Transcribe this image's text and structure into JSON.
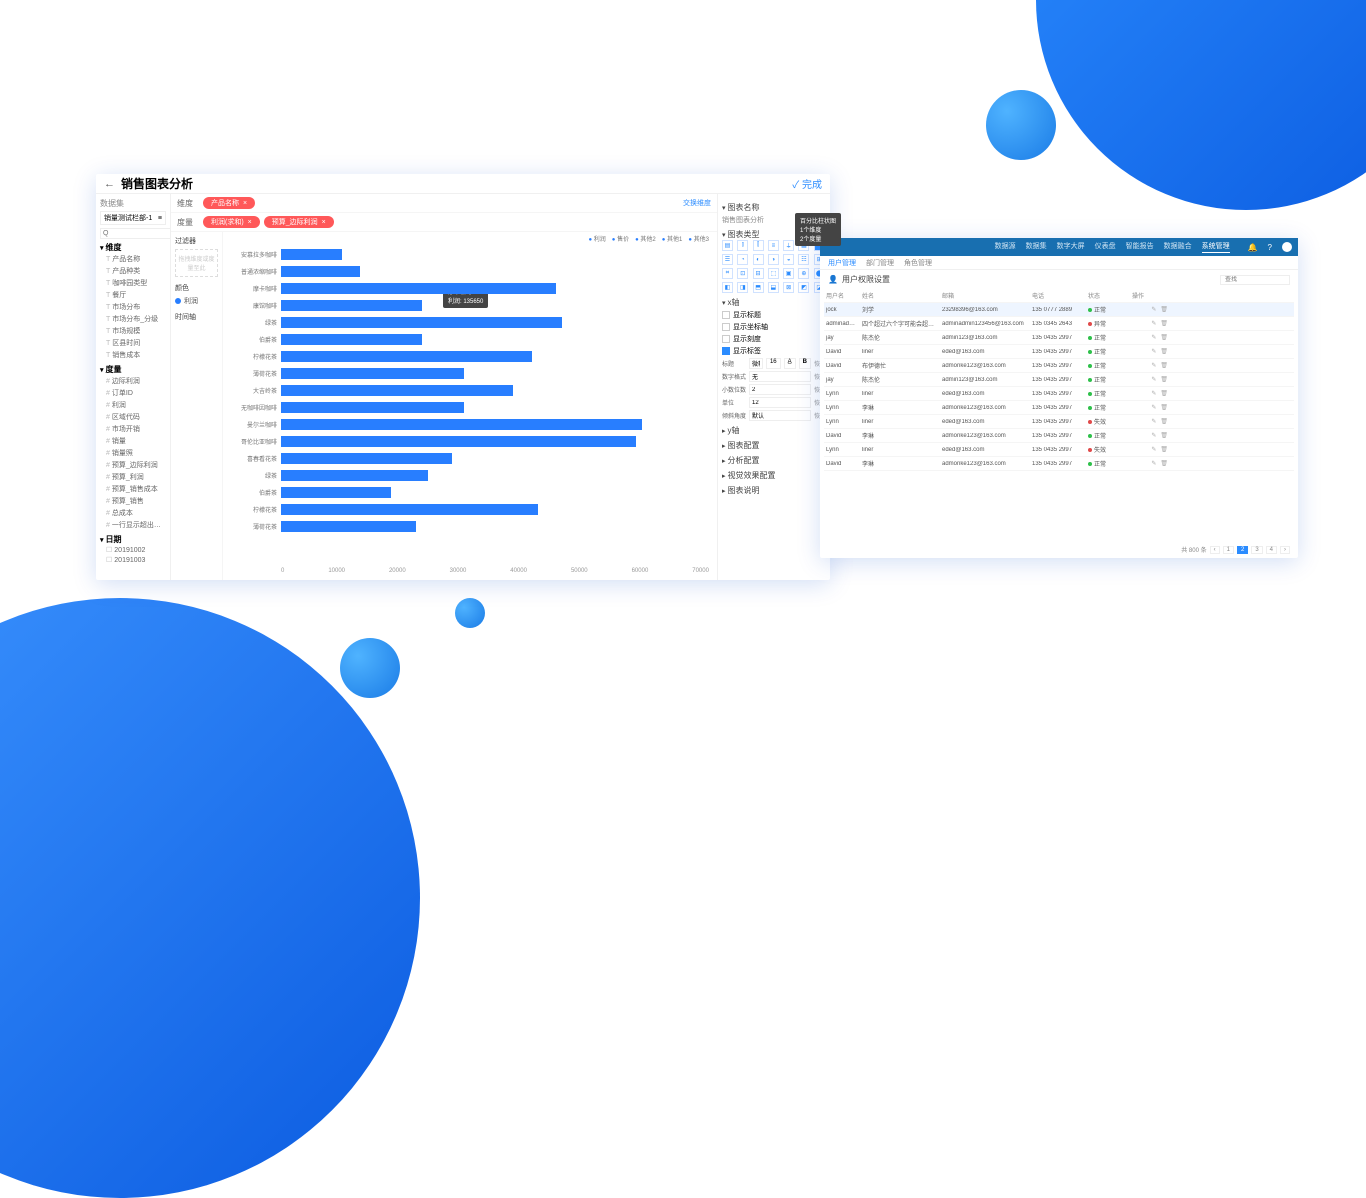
{
  "app1": {
    "title": "销售图表分析",
    "done": "完成",
    "sidebar": {
      "dataset_label": "数据集",
      "dataset_value": "销量测试栏部-1",
      "search_placeholder": "Q",
      "dim_header": "维度",
      "dims": [
        "产品名称",
        "产品种类",
        "咖啡园类型",
        "餐厅",
        "市场分布",
        "市场分布_分级",
        "市场规模",
        "区县时间",
        "销售成本"
      ],
      "meas_header": "度量",
      "meas": [
        "边际利润",
        "订单ID",
        "利润",
        "区域代码",
        "市场开销",
        "销量",
        "销量照",
        "预算_边际利润",
        "预算_利润",
        "预算_销售成本",
        "预算_销售",
        "总成本",
        "一行显示超出…"
      ],
      "date_header": "日期",
      "dates": [
        "20191002",
        "20191003"
      ]
    },
    "dim_row_label": "维度",
    "dim_pill": "产品名称",
    "meas_row_label": "度量",
    "meas_pill1": "利润(求和)",
    "meas_pill2": "预算_边际利润",
    "switch": "交换维度",
    "ctrl": {
      "filter": "过滤器",
      "filter_drop": "拖拽维度或度量至此",
      "color": "颜色",
      "color_item": "利润",
      "time": "时间轴"
    },
    "legend": [
      "利润",
      "售价",
      "其他2",
      "其他1",
      "其他3"
    ],
    "tooltip": {
      "l1": "摩卡咖啡",
      "l2": "利润: 135650"
    }
  },
  "chart_data": {
    "type": "bar",
    "orientation": "horizontal",
    "title": "",
    "xlabel": "",
    "ylabel": "",
    "xlim": [
      0,
      70000
    ],
    "xticks": [
      0,
      10000,
      20000,
      30000,
      40000,
      50000,
      60000,
      70000
    ],
    "categories": [
      "安慕拉多咖啡",
      "普通浓缩咖啡",
      "摩卡咖啡",
      "康馆咖啡",
      "绿茶",
      "伯爵茶",
      "柠檬花茶",
      "薄荷花茶",
      "大吉岭茶",
      "无咖啡因咖啡",
      "曼尔兰咖啡",
      "哥伦比亚咖啡",
      "喜春看花茶",
      "绿茶",
      "伯爵茶",
      "柠檬花茶",
      "薄荷花茶"
    ],
    "values": [
      10000,
      13000,
      45000,
      23000,
      46000,
      23000,
      41000,
      30000,
      38000,
      30000,
      59000,
      58000,
      28000,
      24000,
      18000,
      42000,
      22000
    ],
    "series": [
      {
        "name": "利润",
        "values": [
          10000,
          13000,
          45000,
          23000,
          46000,
          23000,
          41000,
          30000,
          38000,
          30000,
          59000,
          58000,
          28000,
          24000,
          18000,
          42000,
          22000
        ]
      }
    ],
    "legend": [
      "利润",
      "售价",
      "其他2",
      "其他1",
      "其他3"
    ]
  },
  "right": {
    "name_label": "图表名称",
    "name_value": "销售图表分析",
    "type_label": "图表类型",
    "x_label": "x轴",
    "opts": [
      "显示标题",
      "显示坐标轴",
      "显示刻度",
      "显示标签"
    ],
    "checked_idx": 3,
    "title_lbl": "标题",
    "title_val": "微软雅黑",
    "size": "16",
    "numfmt_lbl": "数字格式",
    "numfmt_val": "无",
    "dec_lbl": "小数位数",
    "dec_val": "2",
    "unit_lbl": "单位",
    "unit_val": "12",
    "rot_lbl": "倾斜角度",
    "rot_val": "默认",
    "restore": "恢复",
    "groups": [
      "y轴",
      "图表配置",
      "分析配置",
      "视觉效果配置",
      "图表说明"
    ]
  },
  "tooltip2": {
    "l1": "百分比柱状图",
    "l2": "1个维度",
    "l3": "2个度量"
  },
  "app2": {
    "nav": [
      "数据源",
      "数据集",
      "数字大屏",
      "仪表盘",
      "智能报告",
      "数据融合",
      "系统管理"
    ],
    "nav_active": 6,
    "subtabs": [
      "用户管理",
      "部门管理",
      "角色管理"
    ],
    "sub_active": 0,
    "section": "用户权限设置",
    "search_ph": "查找",
    "cols": [
      "用户名",
      "姓名",
      "邮箱",
      "电话",
      "状态",
      "操作"
    ],
    "rows": [
      {
        "u": "jock",
        "n": "刘学",
        "e": "23298396@163.com",
        "p": "135 0777 2889",
        "s": "正常",
        "sel": true
      },
      {
        "u": "adminadminadminging…",
        "n": "四个超过六个字可能会超长的账单字符超出用…",
        "e": "adminadmin123456@163.com",
        "p": "135 0345 2643",
        "s": "异常"
      },
      {
        "u": "jay",
        "n": "陈杰伦",
        "e": "admin123@163.com",
        "p": "135 0435 2997",
        "s": "正常"
      },
      {
        "u": "David",
        "n": "liner",
        "e": "eded@163.com",
        "p": "135 0435 2997",
        "s": "正常"
      },
      {
        "u": "David",
        "n": "布伊德忙",
        "e": "admonke123@163.com",
        "p": "135 0435 2997",
        "s": "正常"
      },
      {
        "u": "jay",
        "n": "陈杰伦",
        "e": "admin123@163.com",
        "p": "135 0435 2997",
        "s": "正常"
      },
      {
        "u": "Lynn",
        "n": "liner",
        "e": "eded@163.com",
        "p": "135 0435 2997",
        "s": "正常"
      },
      {
        "u": "Lynn",
        "n": "李琳",
        "e": "admonke123@163.com",
        "p": "135 0435 2997",
        "s": "正常"
      },
      {
        "u": "Lynn",
        "n": "liner",
        "e": "eded@163.com",
        "p": "135 0435 2997",
        "s": "失效"
      },
      {
        "u": "David",
        "n": "李琳",
        "e": "admonke123@163.com",
        "p": "135 0435 2997",
        "s": "正常"
      },
      {
        "u": "Lynn",
        "n": "liner",
        "e": "eded@163.com",
        "p": "135 0435 2997",
        "s": "失效"
      },
      {
        "u": "David",
        "n": "李琳",
        "e": "admonke123@163.com",
        "p": "135 0435 2997",
        "s": "正常"
      }
    ],
    "total": "共 800 条",
    "pages": [
      "‹",
      "1",
      "2",
      "3",
      "4",
      "›"
    ],
    "page_active": 2
  }
}
